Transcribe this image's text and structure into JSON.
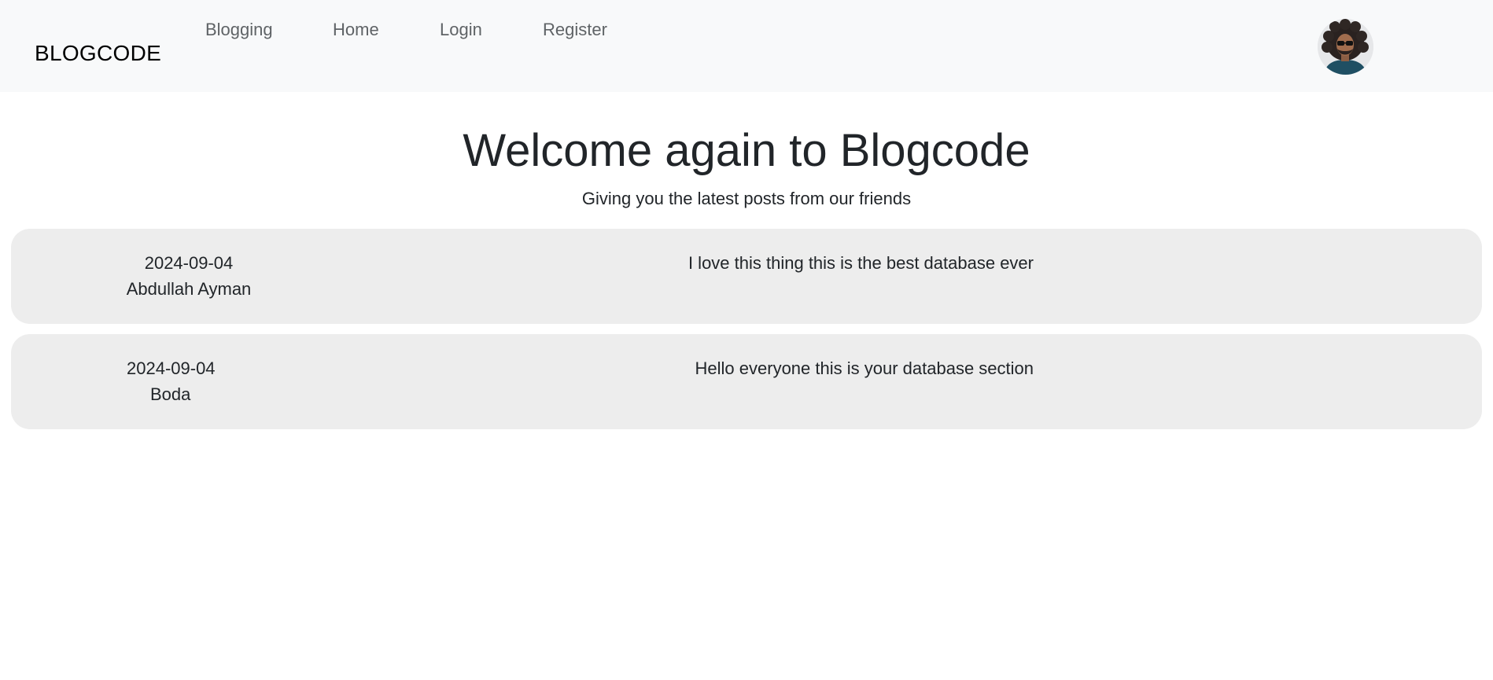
{
  "navbar": {
    "brand": "BLOGCODE",
    "links": [
      {
        "label": "Blogging"
      },
      {
        "label": "Home"
      },
      {
        "label": "Login"
      },
      {
        "label": "Register"
      }
    ],
    "avatar_icon": "user-avatar-photo"
  },
  "hero": {
    "title": "Welcome again to Blogcode",
    "subtitle": "Giving you the latest posts from our friends"
  },
  "posts": [
    {
      "date": "2024-09-04",
      "author": "Abdullah Ayman",
      "content": "I love this thing this is the best database ever"
    },
    {
      "date": "2024-09-04",
      "author": "Boda",
      "content": "Hello everyone this is your database section"
    }
  ],
  "colors": {
    "navbar_bg": "#f8f9fa",
    "card_bg": "#ededed",
    "text": "#212529",
    "nav_link": "#5f6366"
  }
}
